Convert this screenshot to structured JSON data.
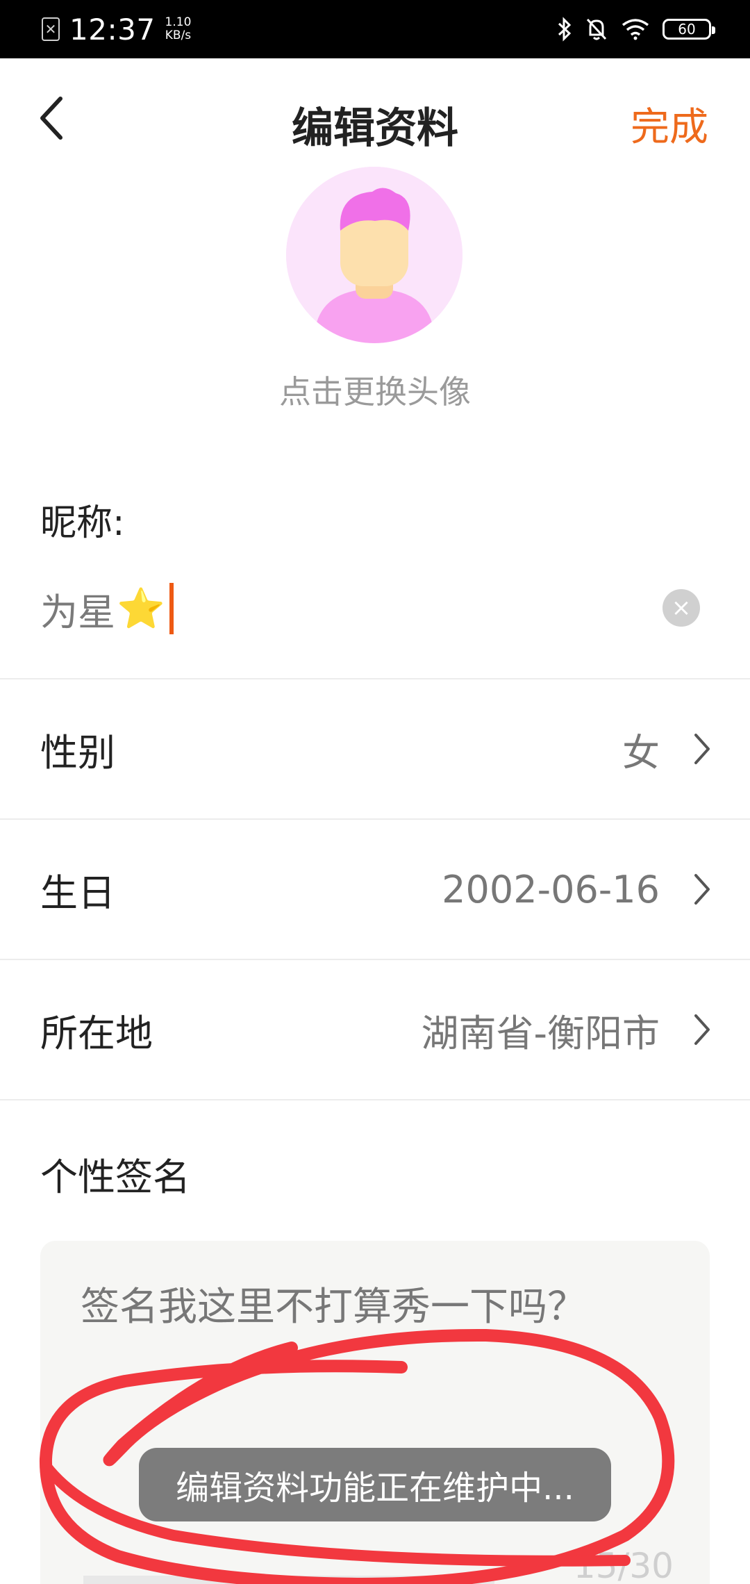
{
  "status_bar": {
    "time": "12:37",
    "net_speed_value": "1.10",
    "net_speed_unit": "KB/s",
    "battery": "60"
  },
  "nav": {
    "title": "编辑资料",
    "done_label": "完成"
  },
  "avatar": {
    "hint": "点击更换头像"
  },
  "nickname": {
    "label": "昵称:",
    "value": "为星",
    "emoji": "⭐"
  },
  "rows": [
    {
      "label": "性别",
      "value": "女"
    },
    {
      "label": "生日",
      "value": "2002-06-16"
    },
    {
      "label": "所在地",
      "value": "湖南省-衡阳市"
    }
  ],
  "signature": {
    "label": "个性签名",
    "placeholder": "签名我这里不打算秀一下吗？",
    "counter": "15/30"
  },
  "toast": "编辑资料功能正在维护中...",
  "colors": {
    "accent": "#ee6a1c",
    "annotation": "#f2383f"
  }
}
